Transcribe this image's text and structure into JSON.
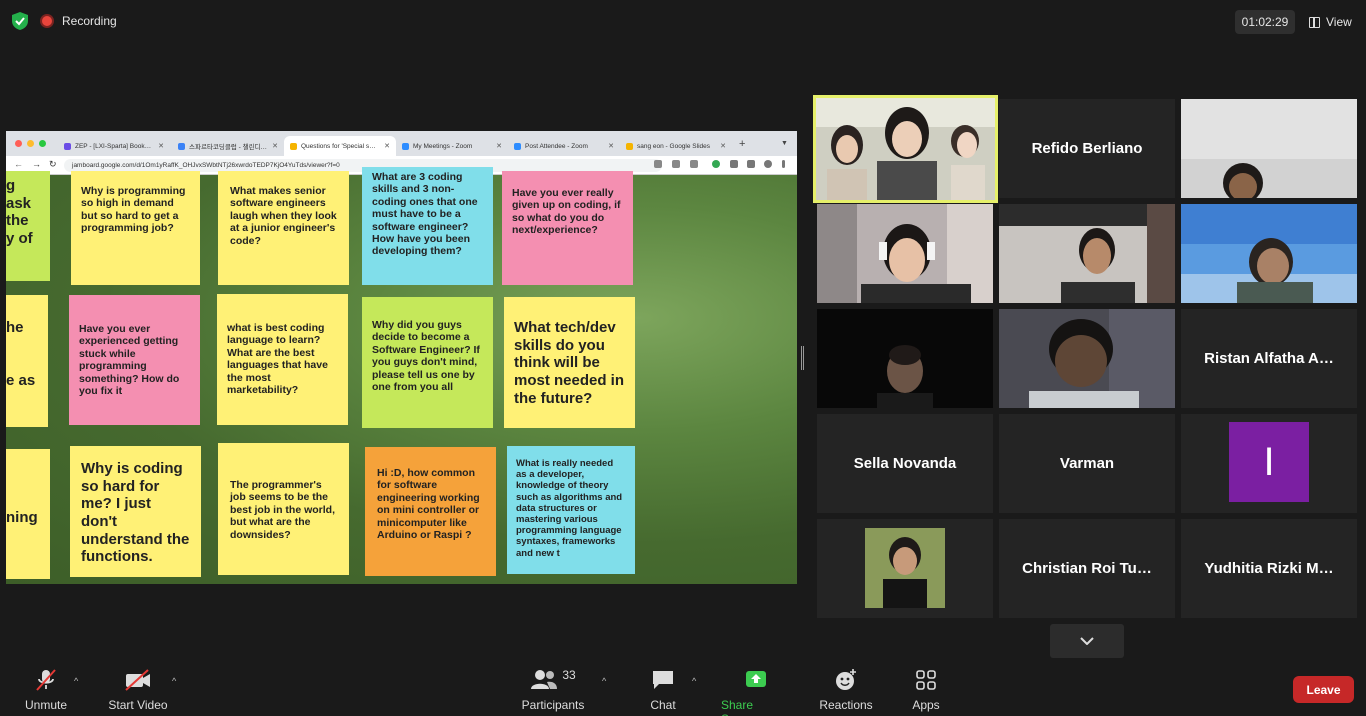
{
  "top_bar": {
    "recording_label": "Recording",
    "timer": "01:02:29",
    "view_label": "View"
  },
  "browser": {
    "tabs": [
      {
        "title": "ZEP - [LXI-Sparta] Book…",
        "favicon_color": "#6b4de6"
      },
      {
        "title": "스파르타코딩클럽 - 챌린디…",
        "favicon_color": "#3b82f6"
      },
      {
        "title": "Questions for 'Special s…",
        "favicon_color": "#f5b400"
      },
      {
        "title": "My Meetings - Zoom",
        "favicon_color": "#2d8cff"
      },
      {
        "title": "Post Attendee - Zoom",
        "favicon_color": "#2d8cff"
      },
      {
        "title": "sang eon - Google Slides",
        "favicon_color": "#f5b400"
      }
    ],
    "url": "jamboard.google.com/d/1Om1yRaffK_OHJvxSWbtNTj26xwrdoTEDP7KjO4YuTds/viewer?f=0"
  },
  "jamboard": {
    "notes": [
      {
        "text": "g\nask\nthe\ny of",
        "color": "green"
      },
      {
        "text": "Why is programming so high in demand but so hard to get a programming job?",
        "color": "yellow"
      },
      {
        "text": "What makes senior software engineers laugh when they look at a junior engineer's code?",
        "color": "yellow"
      },
      {
        "text": "What are 3 coding skills and 3 non-coding ones that one must have to be a software engineer? How have you been developing them?",
        "color": "blue"
      },
      {
        "text": "Have you ever really given up on coding, if so what do you do next/experience?",
        "color": "pink"
      },
      {
        "text": "he\n\n\ne as",
        "color": "yellow"
      },
      {
        "text": "Have you ever experienced getting stuck while programming something? How do you fix it",
        "color": "pink"
      },
      {
        "text": "what is best coding language to learn? What are the best languages that have the most marketability?",
        "color": "yellow"
      },
      {
        "text": "Why did you guys decide to become a Software Engineer? If you guys don't mind, please tell us one by one from you all",
        "color": "green"
      },
      {
        "text": "What tech/dev skills do you think will be most needed in the future?",
        "color": "yellow"
      },
      {
        "text": "ning",
        "color": "yellow"
      },
      {
        "text": "Why is coding so hard for me? I just don't understand the functions.",
        "color": "yellow"
      },
      {
        "text": "The programmer's job seems to be the best job in the world, but what are the downsides?",
        "color": "yellow"
      },
      {
        "text": "Hi :D, how common for software engineering working on mini controller or minicomputer like Arduino or Raspi ?",
        "color": "orange"
      },
      {
        "text": "What is really needed as a developer, knowledge of theory such as algorithms and data structures or mastering various programming language syntaxes, frameworks and new t",
        "color": "blue"
      }
    ]
  },
  "participants_grid": [
    {
      "name": "",
      "type": "video"
    },
    {
      "name": "Refido Berliano",
      "type": "name"
    },
    {
      "name": "",
      "type": "video"
    },
    {
      "name": "",
      "type": "video"
    },
    {
      "name": "",
      "type": "video"
    },
    {
      "name": "",
      "type": "video"
    },
    {
      "name": "",
      "type": "video"
    },
    {
      "name": "",
      "type": "video"
    },
    {
      "name": "Ristan Alfatha A…",
      "type": "name"
    },
    {
      "name": "Sella Novanda",
      "type": "name"
    },
    {
      "name": "Varman",
      "type": "name"
    },
    {
      "name": "",
      "type": "avatar",
      "initial": "I"
    },
    {
      "name": "",
      "type": "video"
    },
    {
      "name": "Christian Roi Tu…",
      "type": "name"
    },
    {
      "name": "Yudhitia Rizki M…",
      "type": "name"
    }
  ],
  "toolbar": {
    "unmute": "Unmute",
    "start_video": "Start Video",
    "participants": "Participants",
    "participants_count": "33",
    "chat": "Chat",
    "share_screen": "Share Screen",
    "reactions": "Reactions",
    "apps": "Apps",
    "leave": "Leave"
  },
  "colors": {
    "share_green": "#3ccc50",
    "leave_red": "#c62828",
    "active_speaker": "#e6f06a",
    "avatar_purple": "#7b1fa2"
  }
}
